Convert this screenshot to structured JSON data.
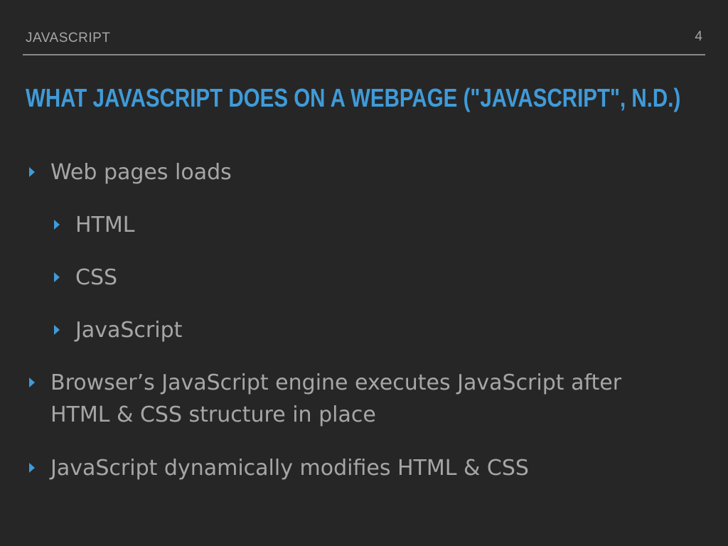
{
  "header": {
    "section_label": "JAVASCRIPT",
    "page_number": "4"
  },
  "title": "WHAT JAVASCRIPT DOES ON A WEBPAGE (\"JAVASCRIPT\", N.D.)",
  "bullets": {
    "b1": "Web pages loads",
    "b1_sub": [
      "HTML",
      "CSS",
      "JavaScript"
    ],
    "b2": "Browser’s JavaScript engine executes JavaScript after HTML & CSS structure in place",
    "b3": "JavaScript dynamically modifies HTML & CSS"
  },
  "colors": {
    "background": "#262626",
    "accent": "#3f9bd9",
    "text": "#a6a6a6"
  }
}
